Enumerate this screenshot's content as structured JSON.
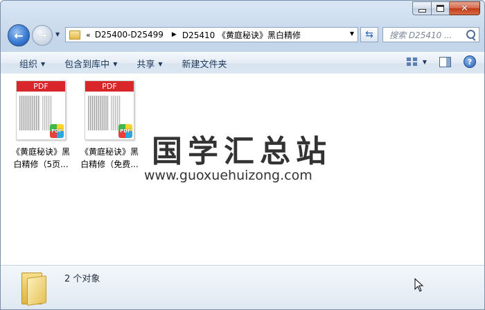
{
  "address": {
    "overflow": "«",
    "crumbs": [
      "D25400-D25499",
      "D25410 《黄庭秘诀》黑白精修"
    ]
  },
  "search": {
    "placeholder": "搜索 D25410 ..."
  },
  "toolbar": {
    "organize": "组织",
    "include_in_library": "包含到库中",
    "share": "共享",
    "new_folder": "新建文件夹"
  },
  "files": [
    {
      "name": "《黄庭秘诀》黑白精修（5页...",
      "type_label": "PDF",
      "badge": "PDF"
    },
    {
      "name": "《黄庭秘诀》黑白精修（免费...",
      "type_label": "PDF",
      "badge": "PDF"
    }
  ],
  "watermark": {
    "title": "国学汇总站",
    "url": "www.guoxuehuizong.com"
  },
  "details": {
    "count": "2 个对象"
  },
  "colors": {
    "accent": "#2b62b3",
    "pdf_banner": "#d8262b"
  },
  "icons": [
    "minimize-icon",
    "maximize-icon",
    "close-icon",
    "back-arrow-icon",
    "forward-arrow-icon",
    "folder-icon",
    "refresh-icon",
    "search-icon",
    "views-icon",
    "preview-pane-icon",
    "help-icon",
    "pdf-badge-icon"
  ]
}
